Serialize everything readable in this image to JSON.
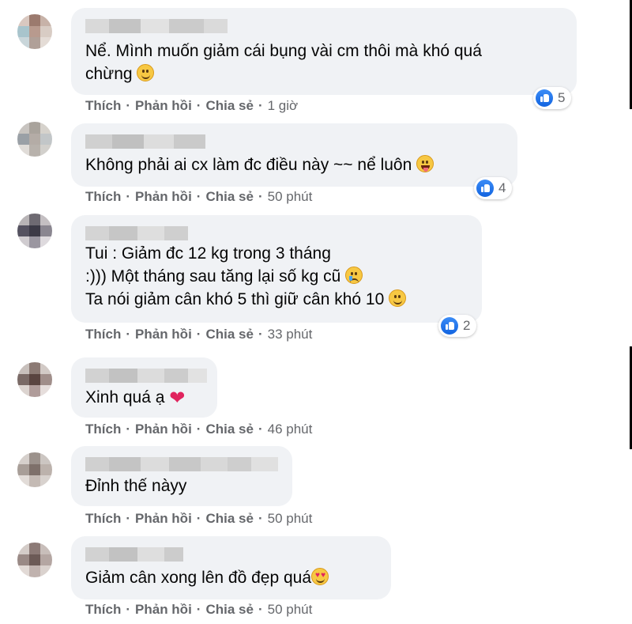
{
  "comments": [
    {
      "lines": [
        "Nể. Mình muốn giảm cái bụng vài cm thôi mà khó quá",
        "chừng"
      ],
      "emoji": "grinning-smile",
      "actions": {
        "like": "Thích",
        "reply": "Phản hồi",
        "share": "Chia sẻ",
        "time": "1 giờ"
      },
      "reaction_count": "5"
    },
    {
      "lines": [
        "Không phải ai cx làm đc điều này ~~ nể luôn"
      ],
      "emoji": "tongue-out",
      "actions": {
        "like": "Thích",
        "reply": "Phản hồi",
        "share": "Chia sẻ",
        "time": "50 phút"
      },
      "reaction_count": "4"
    },
    {
      "lines": [
        "Tui : Giảm đc 12 kg trong 3 tháng",
        ":))) Một tháng sau tăng lại số kg cũ",
        "Ta nói giảm cân khó 5 thì giữ cân khó 10"
      ],
      "emoji": "crying-face, smile",
      "actions": {
        "like": "Thích",
        "reply": "Phản hồi",
        "share": "Chia sẻ",
        "time": "33 phút"
      },
      "reaction_count": "2"
    },
    {
      "lines": [
        "Xinh quá ạ"
      ],
      "emoji": "red-heart",
      "actions": {
        "like": "Thích",
        "reply": "Phản hồi",
        "share": "Chia sẻ",
        "time": "46 phút"
      }
    },
    {
      "lines": [
        "Đỉnh thế nàyy"
      ],
      "actions": {
        "like": "Thích",
        "reply": "Phản hồi",
        "share": "Chia sẻ",
        "time": "50 phút"
      }
    },
    {
      "lines": [
        "Giảm cân xong lên đồ đẹp quá"
      ],
      "emoji": "heart-eyes",
      "actions": {
        "like": "Thích",
        "reply": "Phản hồi",
        "share": "Chia sẻ",
        "time": "50 phút"
      }
    }
  ],
  "colors": {
    "bubble": "#f0f2f5",
    "meta": "#65676b",
    "like_blue": "#1877f2",
    "heart": "#e0245e"
  }
}
